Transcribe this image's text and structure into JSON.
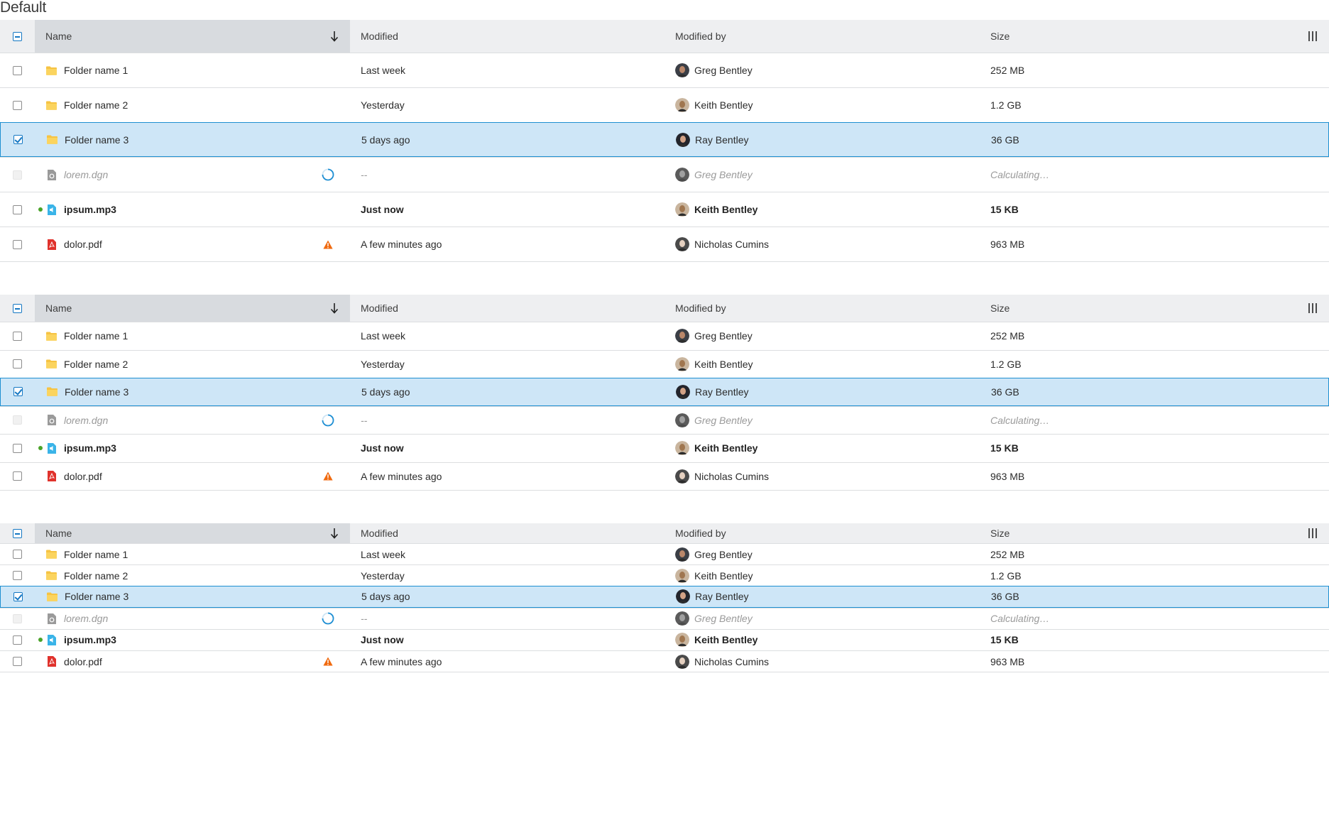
{
  "page_title": "Default",
  "columns": {
    "name": "Name",
    "modified": "Modified",
    "modified_by": "Modified by",
    "size": "Size"
  },
  "rows": [
    {
      "name": "Folder name 1",
      "icon": "folder-icon",
      "modified": "Last week",
      "modified_by": "Greg Bentley",
      "size": "252 MB",
      "state": "normal"
    },
    {
      "name": "Folder name 2",
      "icon": "folder-icon",
      "modified": "Yesterday",
      "modified_by": "Keith Bentley",
      "size": "1.2 GB",
      "state": "normal"
    },
    {
      "name": "Folder name 3",
      "icon": "folder-icon",
      "modified": "5 days ago",
      "modified_by": "Ray Bentley",
      "size": "36 GB",
      "state": "selected"
    },
    {
      "name": "lorem.dgn",
      "icon": "dgn-file-icon",
      "modified": "--",
      "modified_by": "Greg Bentley",
      "size": "Calculating…",
      "state": "loading"
    },
    {
      "name": "ipsum.mp3",
      "icon": "audio-file-icon",
      "modified": "Just now",
      "modified_by": "Keith Bentley",
      "size": "15 KB",
      "state": "new"
    },
    {
      "name": "dolor.pdf",
      "icon": "pdf-file-icon",
      "modified": "A few minutes ago",
      "modified_by": "Nicholas Cumins",
      "size": "963 MB",
      "state": "warning"
    }
  ],
  "densities": [
    "default",
    "condensed",
    "extra-condensed"
  ],
  "colors": {
    "selected_bg": "#cee6f7",
    "selected_border": "#1e8fd1",
    "header_bg": "#eeeff1",
    "sorted_header_bg": "#d8dbdf",
    "warning": "#f06a0f",
    "new_dot": "#4aa329",
    "folder": "#f6c343",
    "pdf": "#e0322c",
    "audio": "#3ab4e8"
  }
}
